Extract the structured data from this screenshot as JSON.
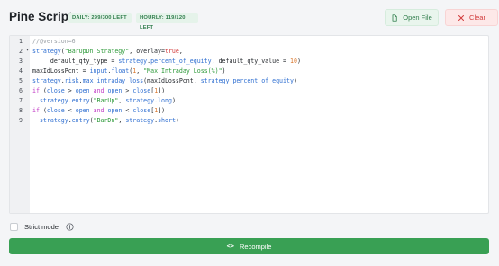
{
  "header": {
    "title": "Pine Script",
    "badges": {
      "daily": "DAILY: 299/300 LEFT",
      "hourly": "HOURLY: 119/120 LEFT"
    },
    "open_file_label": "Open File",
    "clear_label": "Clear"
  },
  "editor": {
    "lines": [
      {
        "num": "1",
        "text": "//@version=6"
      },
      {
        "num": "2",
        "text": "strategy(\"BarUpDn Strategy\", overlay=true,"
      },
      {
        "num": "3",
        "text": "     default_qty_type = strategy.percent_of_equity, default_qty_value = 10)"
      },
      {
        "num": "4",
        "text": "maxIdLossPcnt = input.float(1, \"Max Intraday Loss(%)\")"
      },
      {
        "num": "5",
        "text": "strategy.risk.max_intraday_loss(maxIdLossPcnt, strategy.percent_of_equity)"
      },
      {
        "num": "6",
        "text": "if (close > open and open > close[1])"
      },
      {
        "num": "7",
        "text": "  strategy.entry(\"BarUp\", strategy.long)"
      },
      {
        "num": "8",
        "text": "if (close < open and open < close[1])"
      },
      {
        "num": "9",
        "text": "  strategy.entry(\"BarDn\", strategy.short)"
      }
    ]
  },
  "footer": {
    "strict_mode_label": "Strict mode",
    "strict_mode_checked": false
  },
  "actions": {
    "recompile_label": "Recompile"
  },
  "icons": {
    "open_file": "file-icon",
    "clear": "close-icon",
    "info": "info-icon",
    "recompile": "code-icon",
    "fold": "chevron-down-icon"
  },
  "colors": {
    "accent_green": "#39a054",
    "badge_bg": "#e5f3ea",
    "badge_text": "#2f7d4b",
    "clear_bg": "#fde8e8",
    "clear_text": "#d13a3a",
    "comment": "#9aa0a6",
    "string": "#2e9a3a",
    "keyword": "#c13bc6",
    "number": "#d9752a",
    "builtin": "#2f6fd1",
    "literal": "#d23a3a"
  }
}
